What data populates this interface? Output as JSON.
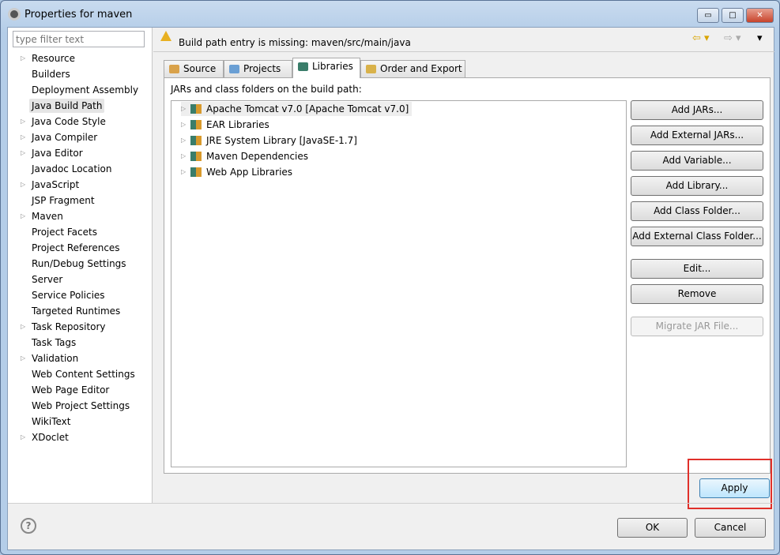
{
  "window": {
    "title": "Properties for maven",
    "minimize": "▭",
    "maximize": "□",
    "close": "✕"
  },
  "filter": {
    "placeholder": "type filter text"
  },
  "tree": [
    {
      "label": "Resource",
      "expandable": true
    },
    {
      "label": "Builders"
    },
    {
      "label": "Deployment Assembly"
    },
    {
      "label": "Java Build Path",
      "selected": true
    },
    {
      "label": "Java Code Style",
      "expandable": true
    },
    {
      "label": "Java Compiler",
      "expandable": true
    },
    {
      "label": "Java Editor",
      "expandable": true
    },
    {
      "label": "Javadoc Location"
    },
    {
      "label": "JavaScript",
      "expandable": true
    },
    {
      "label": "JSP Fragment"
    },
    {
      "label": "Maven",
      "expandable": true
    },
    {
      "label": "Project Facets"
    },
    {
      "label": "Project References"
    },
    {
      "label": "Run/Debug Settings"
    },
    {
      "label": "Server"
    },
    {
      "label": "Service Policies"
    },
    {
      "label": "Targeted Runtimes"
    },
    {
      "label": "Task Repository",
      "expandable": true
    },
    {
      "label": "Task Tags"
    },
    {
      "label": "Validation",
      "expandable": true
    },
    {
      "label": "Web Content Settings"
    },
    {
      "label": "Web Page Editor"
    },
    {
      "label": "Web Project Settings"
    },
    {
      "label": "WikiText"
    },
    {
      "label": "XDoclet",
      "expandable": true
    }
  ],
  "header": {
    "message": "Build path entry is missing: maven/src/main/java",
    "back": "⇦ ▾",
    "forward": "⇨ ▾",
    "menu": "▾"
  },
  "tabs": [
    {
      "label": "Source"
    },
    {
      "label": "Projects"
    },
    {
      "label": "Libraries",
      "active": true
    },
    {
      "label": "Order and Export"
    }
  ],
  "libraries": {
    "label": "JARs and class folders on the build path:",
    "items": [
      "Apache Tomcat v7.0 [Apache Tomcat v7.0]",
      "EAR Libraries",
      "JRE System Library [JavaSE-1.7]",
      "Maven Dependencies",
      "Web App Libraries"
    ]
  },
  "buttons": [
    "Add JARs...",
    "Add External JARs...",
    "Add Variable...",
    "Add Library...",
    "Add Class Folder...",
    "Add External Class Folder...",
    "Edit...",
    "Remove",
    "Migrate JAR File..."
  ],
  "footer": {
    "apply": "Apply",
    "ok": "OK",
    "cancel": "Cancel",
    "help": "?"
  },
  "colors": {
    "highlight": "#e0302a",
    "warning": "#e8b021"
  }
}
